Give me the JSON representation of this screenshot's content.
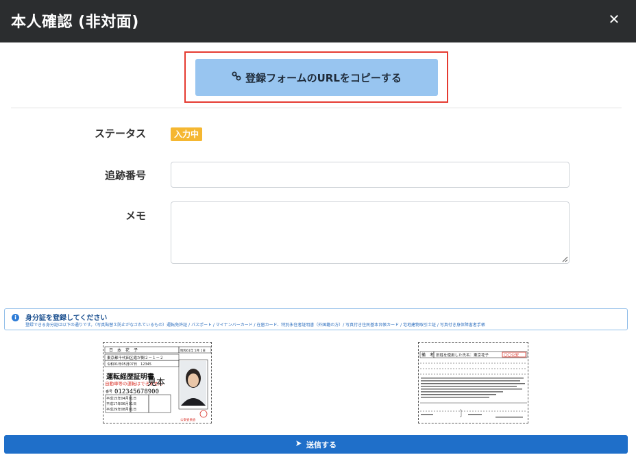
{
  "header": {
    "title": "本人確認 (非対面)",
    "close_icon": "close-icon"
  },
  "copy_button": {
    "label": "登録フォームのURLをコピーする",
    "icon": "link-icon"
  },
  "form": {
    "status": {
      "label": "ステータス",
      "badge": "入力中",
      "badge_color": "#f5b731"
    },
    "tracking": {
      "label": "追跡番号",
      "value": ""
    },
    "memo": {
      "label": "メモ",
      "value": ""
    }
  },
  "info": {
    "icon": "info-icon",
    "title": "身分証を登録してください",
    "description": "登録できる身分証は以下の通りです。（写真貼替え防止がなされているもの）運転免許証 / パスポート / マイナンバーカード / 在留カード、特別永住者証明書（外国籍の方）/ 写真付き住民基本台帳カード / 宅地建物取引士証 / 写真付き身体障害者手帳"
  },
  "license_front": {
    "name": "日　本　花　子",
    "birth": "昭和61年 5月 1日",
    "address": "東京都千代田区霞が関２－１－２",
    "issued": "令和01年05月07日　12345",
    "doc_title": "運転経歴証明書",
    "note": "自動車等の運転はできません",
    "number_label": "番号",
    "number": "012345678900",
    "sample_watermark": "見本",
    "issuer": "公安委員会",
    "dates": [
      "平成15年04月01日",
      "平成17年06月01日",
      "平成29年08月01日"
    ]
  },
  "license_back": {
    "remarks_label": "備　考",
    "remarks": "旧姓を使用した氏名：東京花子",
    "stamp": "〇〇公安"
  },
  "submit_button": {
    "label": "送信する",
    "icon": "send-icon"
  },
  "colors": {
    "header_bg": "#2b2d2f",
    "copy_button_bg": "#98c5f0",
    "highlight_border": "#e53a30",
    "submit_bg": "#1f6fc9",
    "info_border": "#8fbde9"
  }
}
